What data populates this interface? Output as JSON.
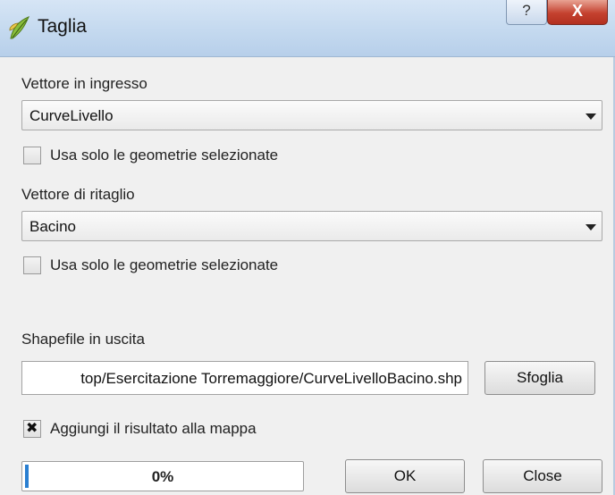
{
  "window": {
    "title": "Taglia",
    "icon": "qgis-leaf-icon",
    "help_label": "?",
    "close_label": "X"
  },
  "input_vector": {
    "label": "Vettore in ingresso",
    "selected": "CurveLivello",
    "selected_only_label": "Usa solo le geometrie selezionate",
    "selected_only_checked": false
  },
  "clip_vector": {
    "label": "Vettore di ritaglio",
    "selected": "Bacino",
    "selected_only_label": "Usa solo le geometrie selezionate",
    "selected_only_checked": false
  },
  "output": {
    "label": "Shapefile in uscita",
    "path": "top/Esercitazione Torremaggiore/CurveLivelloBacino.shp",
    "browse_label": "Sfoglia",
    "add_to_map_label": "Aggiungi il risultato alla mappa",
    "add_to_map_checked": true
  },
  "footer": {
    "progress_text": "0%",
    "progress_value": 0,
    "ok_label": "OK",
    "close_label": "Close"
  },
  "colors": {
    "titlebar": "#c4d9ef",
    "close_button": "#c4412f",
    "progress_fill": "#2a7fd1",
    "dialog_bg": "#f0f0f0"
  }
}
